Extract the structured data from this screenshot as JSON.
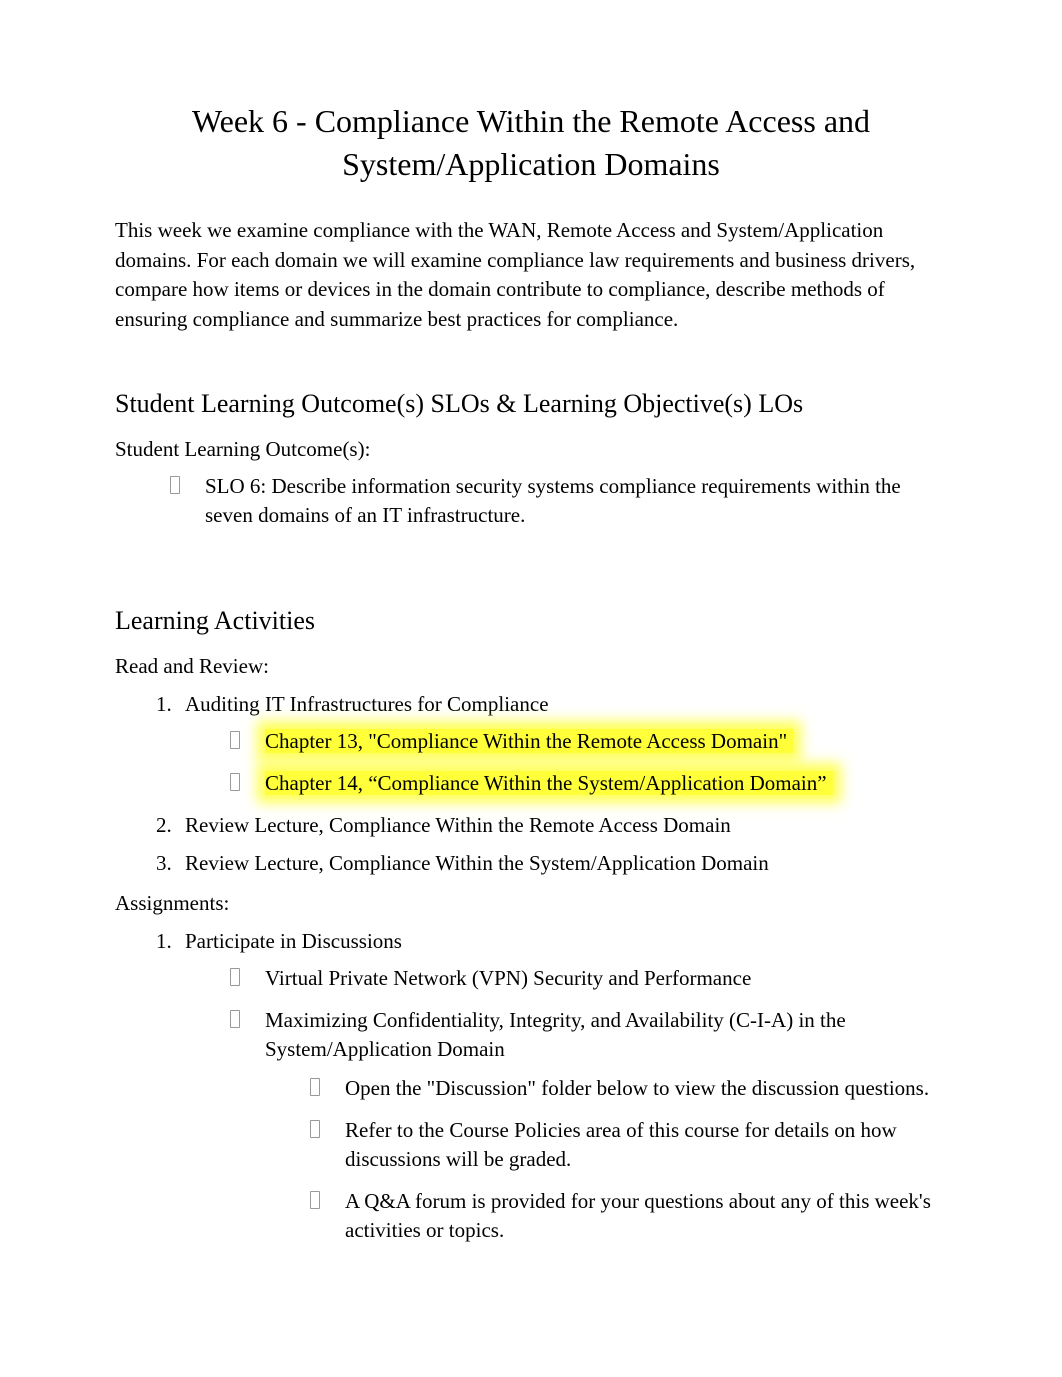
{
  "title": "Week 6 - Compliance Within the Remote Access and System/Application Domains",
  "intro": " This week we examine compliance with the WAN, Remote Access and System/Application domains. For each domain we will examine compliance law requirements and business drivers, compare how items or devices in the domain contribute to compliance, describe methods of ensuring compliance and summarize best practices for compliance.",
  "slo_heading": "Student Learning Outcome(s) SLOs & Learning Objective(s) LOs",
  "slo_label": "Student Learning Outcome(s):",
  "slo_items": [
    "SLO 6: Describe information security systems compliance requirements within the seven domains of an IT infrastructure."
  ],
  "learning_heading": "Learning Activities",
  "read_review_label": "Read and Review:",
  "read_items": {
    "1": "Auditing IT Infrastructures for Compliance",
    "1_sub": [
      "Chapter 13, \"Compliance Within the Remote Access Domain\"",
      "Chapter 14, “Compliance Within the System/Application Domain”"
    ],
    "2": "Review Lecture, Compliance Within the Remote Access Domain",
    "3": "Review Lecture, Compliance Within the System/Application Domain"
  },
  "assignments_label": "Assignments:",
  "assignments": {
    "1": "Participate in Discussions",
    "1_sub": [
      "Virtual Private Network (VPN) Security and Performance",
      "Maximizing Confidentiality, Integrity, and Availability (C-I-A) in the System/Application Domain"
    ],
    "1_sub2": [
      "Open the \"Discussion\" folder below to view the discussion questions.",
      "Refer to the Course Policies area of this course for details on how discussions will be graded.",
      "A Q&A forum is provided for your questions about any of this week's activities or topics."
    ]
  }
}
